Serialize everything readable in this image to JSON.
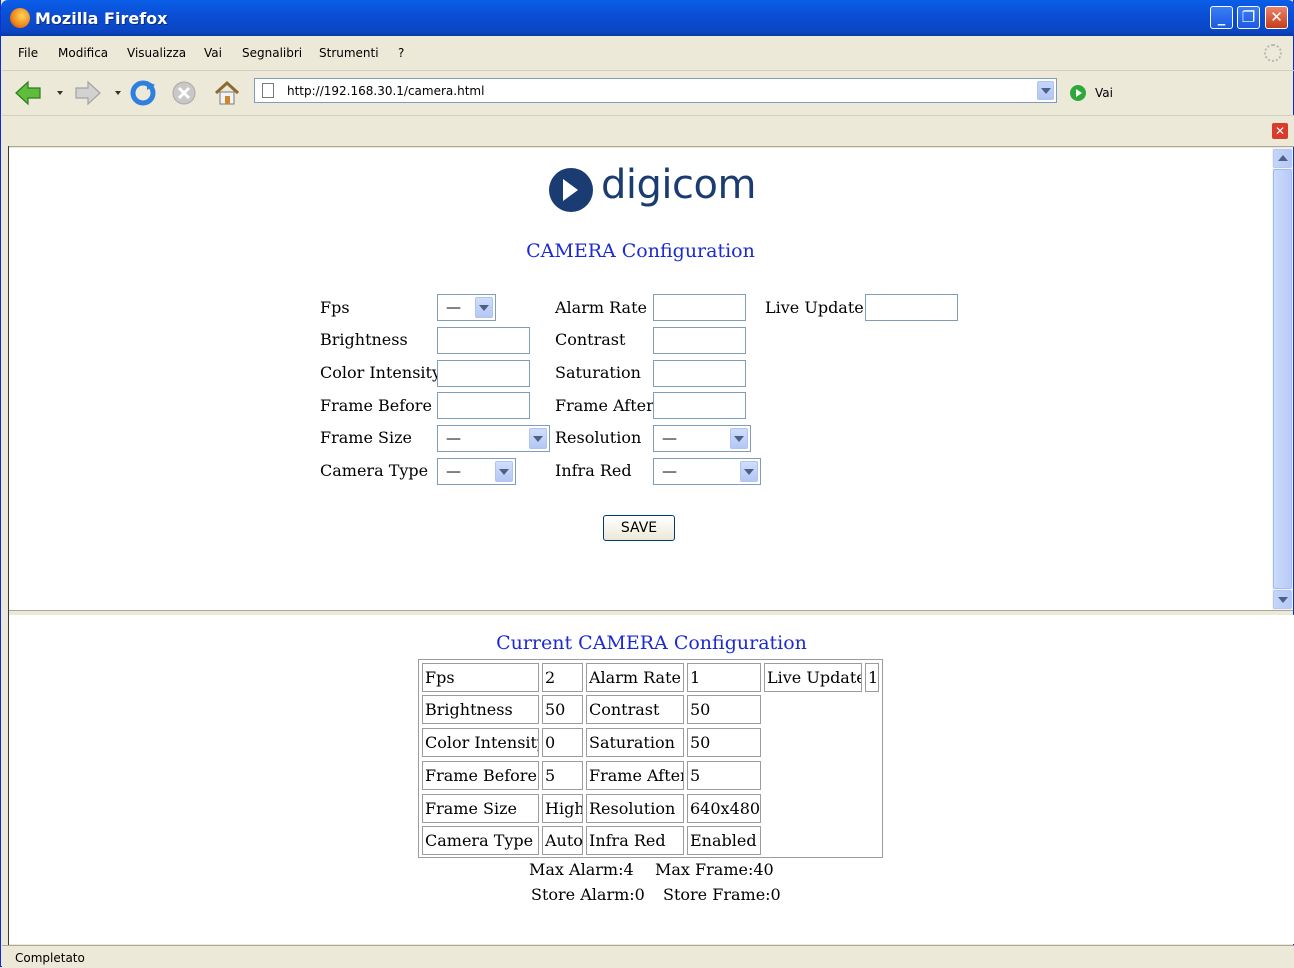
{
  "window": {
    "title": "Mozilla Firefox"
  },
  "menu": [
    "File",
    "Modifica",
    "Visualizza",
    "Vai",
    "Segnalibri",
    "Strumenti",
    "?"
  ],
  "nav": {
    "url": "http://192.168.30.1/camera.html",
    "go_label": "Vai"
  },
  "logo": {
    "text": "digicom"
  },
  "form": {
    "title": "CAMERA Configuration",
    "labels": {
      "fps": "Fps",
      "alarm_rate": "Alarm Rate",
      "live_update": "Live Update",
      "brightness": "Brightness",
      "contrast": "Contrast",
      "color_intensity": "Color Intensity",
      "saturation": "Saturation",
      "frame_before": "Frame Before",
      "frame_after": "Frame After",
      "frame_size": "Frame Size",
      "resolution": "Resolution",
      "camera_type": "Camera Type",
      "infra_red": "Infra Red"
    },
    "selects": {
      "fps": "—",
      "frame_size": "—",
      "resolution": "—",
      "camera_type": "—",
      "infra_red": "—"
    },
    "save_label": "SAVE"
  },
  "current": {
    "title": "Current CAMERA Configuration",
    "rows": [
      [
        "Fps",
        "2",
        "Alarm Rate",
        "1",
        "Live Update",
        "1"
      ],
      [
        "Brightness",
        "50",
        "Contrast",
        "50"
      ],
      [
        "Color Intensity",
        "0",
        "Saturation",
        "50"
      ],
      [
        "Frame Before",
        "5",
        "Frame After",
        "5"
      ],
      [
        "Frame Size",
        "High",
        "Resolution",
        "640x480"
      ],
      [
        "Camera Type",
        "Auto",
        "Infra Red",
        "Enabled"
      ]
    ],
    "stats": {
      "max_alarm": "Max Alarm:4",
      "max_frame": "Max Frame:40",
      "store_alarm": "Store Alarm:0",
      "store_frame": "Store Frame:0"
    }
  },
  "status": "Completato"
}
